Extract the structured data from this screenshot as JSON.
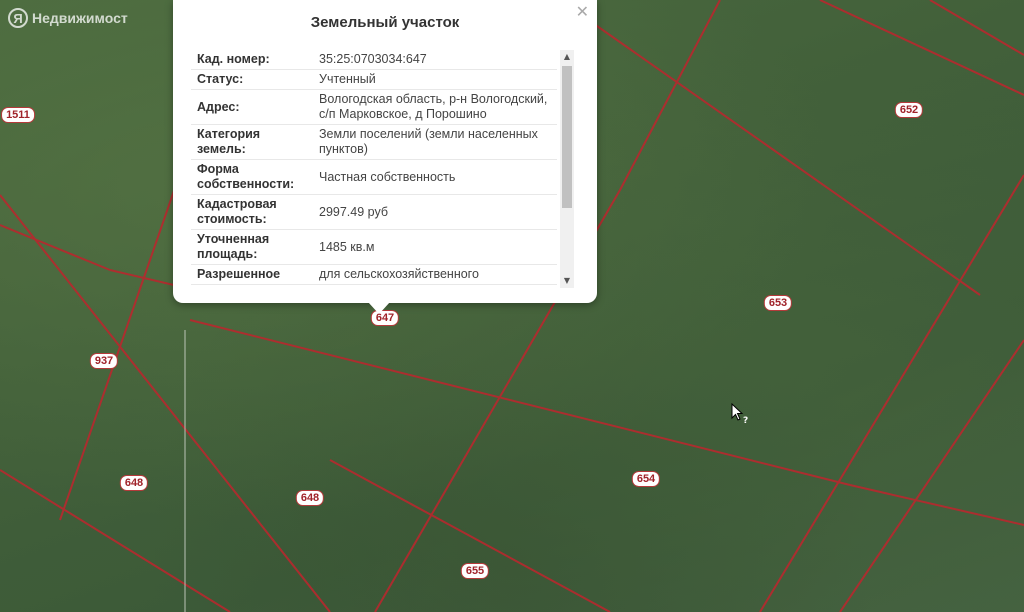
{
  "logo": {
    "mark": "Я",
    "text": "Недвижимост"
  },
  "popup": {
    "title": "Земельный участок",
    "close_icon": "close-icon",
    "rows": [
      {
        "key": "Кад. номер",
        "value": "35:25:0703034:647"
      },
      {
        "key": "Статус",
        "value": "Учтенный"
      },
      {
        "key": "Адрес",
        "value": "Вологодская область, р-н Вологодский, с/п Марковское, д Порошино"
      },
      {
        "key": "Категория земель",
        "value": "Земли поселений (земли населенных пунктов)"
      },
      {
        "key": "Форма собственности",
        "value": "Частная собственность"
      },
      {
        "key": "Кадастровая стоимость",
        "value": "2997.49 руб"
      },
      {
        "key": "Уточненная площадь",
        "value": "1485 кв.м"
      },
      {
        "key": "Разрешенное",
        "value": "для сельскохозяйственного"
      }
    ]
  },
  "parcel_labels": [
    "1511",
    "652",
    "653",
    "647",
    "937",
    "648",
    "648",
    "654",
    "655"
  ],
  "colors": {
    "parcel_line": "#b8282e",
    "label_text": "#a0232a"
  }
}
